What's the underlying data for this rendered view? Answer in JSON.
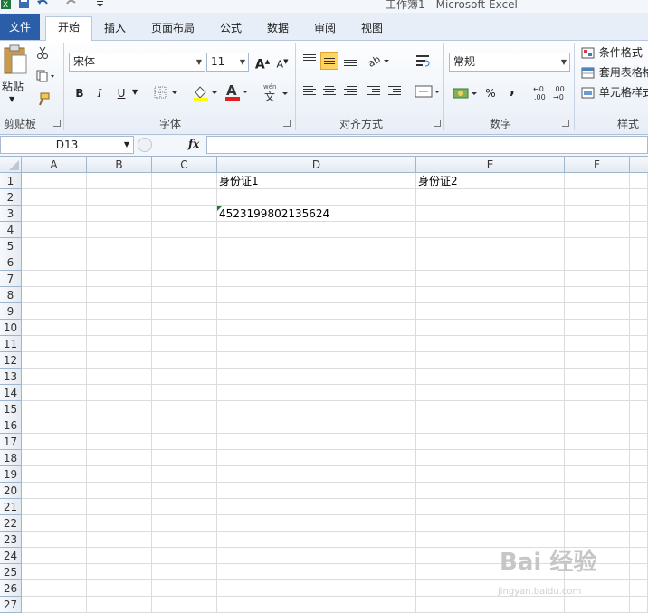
{
  "window": {
    "title": "工作簿1 - Microsoft Excel"
  },
  "tabs": {
    "file": "文件",
    "home": "开始",
    "insert": "插入",
    "layout": "页面布局",
    "formulas": "公式",
    "data": "数据",
    "review": "审阅",
    "view": "视图"
  },
  "ribbon": {
    "clipboard": {
      "label": "剪贴板",
      "paste": "粘贴"
    },
    "font": {
      "label": "字体",
      "name": "宋体",
      "size": "11",
      "bold": "B",
      "italic": "I",
      "underline": "U",
      "grow": "A",
      "shrink": "A",
      "wen": "文",
      "font_color_letter": "A"
    },
    "alignment": {
      "label": "对齐方式"
    },
    "number": {
      "label": "数字",
      "format": "常规",
      "percent": "%",
      "comma": ","
    },
    "styles": {
      "label": "样式",
      "conditional": "条件格式",
      "table": "套用表格格",
      "cell": "单元格样式"
    }
  },
  "formula_bar": {
    "name_box": "D13",
    "fx": "fx",
    "value": ""
  },
  "sheet": {
    "columns": [
      "A",
      "B",
      "C",
      "D",
      "E",
      "F"
    ],
    "rows": [
      "1",
      "2",
      "3",
      "4",
      "5",
      "6",
      "7",
      "8",
      "9",
      "10",
      "11",
      "12",
      "13",
      "14",
      "15",
      "16",
      "17",
      "18",
      "19",
      "20",
      "21",
      "22",
      "23",
      "24",
      "25",
      "26",
      "27"
    ],
    "cells": {
      "D1": "身份证1",
      "E1": "身份证2",
      "D3": "4523199802135624"
    }
  },
  "watermark": {
    "main": "Bai 经验",
    "sub": "jingyan.baidu.com"
  },
  "colors": {
    "file_tab": "#2a5ea8",
    "accent_highlight": "#ffd560",
    "number_indicator": "#1e7a34"
  }
}
